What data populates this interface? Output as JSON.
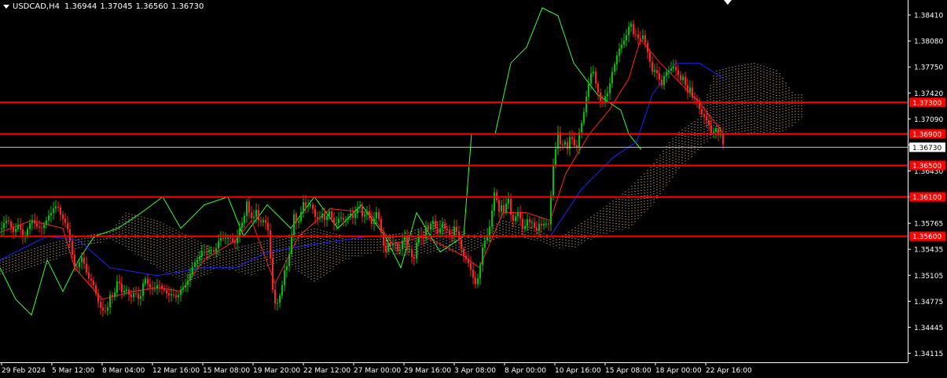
{
  "window": {
    "symbol": "USDCAD,H4",
    "open": "1.36944",
    "high": "1.37045",
    "low": "1.36560",
    "close": "1.36730"
  },
  "colors": {
    "background": "#000000",
    "axis": "#ffffff",
    "bull_candle": "#00c000",
    "bear_candle": "#ff2020",
    "tenkan": "#ff2020",
    "kijun": "#2020ff",
    "chikou": "#30ff30",
    "cloud": "#ffdab0",
    "level_line": "#ff0000",
    "price_line": "#c0c0c0"
  },
  "chart_data": {
    "type": "candlestick",
    "instrument": "USDCAD",
    "timeframe": "H4",
    "indicator": "Ichimoku Kinko Hyo",
    "ylim": [
      1.34,
      1.386
    ],
    "y_ticks": [
      "1.38410",
      "1.38080",
      "1.37750",
      "1.37420",
      "1.37090",
      "1.36760",
      "1.36430",
      "1.36100",
      "1.35765",
      "1.35435",
      "1.35105",
      "1.34775",
      "1.34445",
      "1.34115"
    ],
    "x_ticks": [
      "29 Feb 2024",
      "5 Mar 12:00",
      "8 Mar 04:00",
      "12 Mar 16:00",
      "15 Mar 08:00",
      "19 Mar 20:00",
      "22 Mar 12:00",
      "27 Mar 00:00",
      "29 Mar 16:00",
      "3 Apr 08:00",
      "8 Apr 00:00",
      "10 Apr 16:00",
      "15 Apr 08:00",
      "18 Apr 00:00",
      "22 Apr 16:00"
    ],
    "current_price": "1.36730",
    "levels": [
      {
        "label": "1.37300",
        "value": 1.373
      },
      {
        "label": "1.36900",
        "value": 1.369
      },
      {
        "label": "1.36500",
        "value": 1.365
      },
      {
        "label": "1.36100",
        "value": 1.361
      },
      {
        "label": "1.35600",
        "value": 1.356
      }
    ],
    "close_path": [
      [
        0,
        1.3569
      ],
      [
        6,
        1.3575
      ],
      [
        12,
        1.358
      ],
      [
        18,
        1.3565
      ],
      [
        24,
        1.3572
      ],
      [
        30,
        1.356
      ],
      [
        36,
        1.357
      ],
      [
        42,
        1.358
      ],
      [
        48,
        1.3575
      ],
      [
        54,
        1.3566
      ],
      [
        58,
        1.3578
      ],
      [
        62,
        1.359
      ],
      [
        68,
        1.3593
      ],
      [
        74,
        1.3596
      ],
      [
        80,
        1.3585
      ],
      [
        85,
        1.357
      ],
      [
        90,
        1.3548
      ],
      [
        96,
        1.352
      ],
      [
        100,
        1.3522
      ],
      [
        104,
        1.353
      ],
      [
        108,
        1.3525
      ],
      [
        112,
        1.351
      ],
      [
        118,
        1.3497
      ],
      [
        124,
        1.3482
      ],
      [
        128,
        1.3472
      ],
      [
        132,
        1.3462
      ],
      [
        136,
        1.3462
      ],
      [
        140,
        1.3488
      ],
      [
        145,
        1.3485
      ],
      [
        150,
        1.3503
      ],
      [
        155,
        1.349
      ],
      [
        160,
        1.3497
      ],
      [
        166,
        1.3477
      ],
      [
        172,
        1.3493
      ],
      [
        178,
        1.3478
      ],
      [
        184,
        1.3506
      ],
      [
        190,
        1.35
      ],
      [
        196,
        1.3488
      ],
      [
        202,
        1.35
      ],
      [
        208,
        1.3495
      ],
      [
        214,
        1.348
      ],
      [
        220,
        1.349
      ],
      [
        226,
        1.3482
      ],
      [
        232,
        1.3492
      ],
      [
        238,
        1.3505
      ],
      [
        244,
        1.3515
      ],
      [
        250,
        1.353
      ],
      [
        256,
        1.3542
      ],
      [
        262,
        1.3535
      ],
      [
        268,
        1.3547
      ],
      [
        274,
        1.354
      ],
      [
        280,
        1.3556
      ],
      [
        286,
        1.3562
      ],
      [
        292,
        1.3555
      ],
      [
        298,
        1.355
      ],
      [
        304,
        1.357
      ],
      [
        310,
        1.3576
      ],
      [
        314,
        1.3605
      ],
      [
        318,
        1.359
      ],
      [
        322,
        1.358
      ],
      [
        326,
        1.359
      ],
      [
        330,
        1.3576
      ],
      [
        334,
        1.3586
      ],
      [
        338,
        1.3576
      ],
      [
        342,
        1.356
      ],
      [
        346,
        1.35
      ],
      [
        350,
        1.3478
      ],
      [
        354,
        1.3475
      ],
      [
        358,
        1.3488
      ],
      [
        362,
        1.3518
      ],
      [
        366,
        1.3528
      ],
      [
        370,
        1.355
      ],
      [
        374,
        1.3585
      ],
      [
        378,
        1.3575
      ],
      [
        382,
        1.359
      ],
      [
        386,
        1.3602
      ],
      [
        390,
        1.3592
      ],
      [
        394,
        1.3604
      ],
      [
        398,
        1.3598
      ],
      [
        402,
        1.358
      ],
      [
        406,
        1.3578
      ],
      [
        410,
        1.359
      ],
      [
        414,
        1.3582
      ],
      [
        418,
        1.3592
      ],
      [
        422,
        1.358
      ],
      [
        426,
        1.3575
      ],
      [
        430,
        1.3585
      ],
      [
        434,
        1.3582
      ],
      [
        438,
        1.3576
      ],
      [
        442,
        1.3585
      ],
      [
        446,
        1.3592
      ],
      [
        450,
        1.358
      ],
      [
        454,
        1.3592
      ],
      [
        458,
        1.36
      ],
      [
        462,
        1.3585
      ],
      [
        466,
        1.3592
      ],
      [
        470,
        1.358
      ],
      [
        474,
        1.3575
      ],
      [
        478,
        1.3597
      ],
      [
        482,
        1.358
      ],
      [
        486,
        1.3555
      ],
      [
        490,
        1.354
      ],
      [
        494,
        1.3555
      ],
      [
        498,
        1.3545
      ],
      [
        502,
        1.355
      ],
      [
        506,
        1.3543
      ],
      [
        510,
        1.3548
      ],
      [
        514,
        1.3562
      ],
      [
        518,
        1.354
      ],
      [
        522,
        1.3546
      ],
      [
        526,
        1.3528
      ],
      [
        530,
        1.355
      ],
      [
        534,
        1.356
      ],
      [
        538,
        1.3555
      ],
      [
        542,
        1.3575
      ],
      [
        546,
        1.3565
      ],
      [
        550,
        1.358
      ],
      [
        554,
        1.3572
      ],
      [
        558,
        1.3566
      ],
      [
        562,
        1.3575
      ],
      [
        566,
        1.3567
      ],
      [
        570,
        1.357
      ],
      [
        574,
        1.356
      ],
      [
        578,
        1.357
      ],
      [
        582,
        1.356
      ],
      [
        586,
        1.355
      ],
      [
        590,
        1.3538
      ],
      [
        594,
        1.3527
      ],
      [
        598,
        1.3518
      ],
      [
        602,
        1.351
      ],
      [
        606,
        1.35
      ],
      [
        610,
        1.3513
      ],
      [
        614,
        1.3543
      ],
      [
        618,
        1.356
      ],
      [
        622,
        1.3568
      ],
      [
        626,
        1.359
      ],
      [
        630,
        1.362
      ],
      [
        634,
        1.3592
      ],
      [
        638,
        1.3602
      ],
      [
        642,
        1.3584
      ],
      [
        646,
        1.3612
      ],
      [
        650,
        1.359
      ],
      [
        654,
        1.358
      ],
      [
        658,
        1.359
      ],
      [
        662,
        1.358
      ],
      [
        666,
        1.3568
      ],
      [
        670,
        1.3585
      ],
      [
        674,
        1.3575
      ],
      [
        678,
        1.3575
      ],
      [
        682,
        1.3568
      ],
      [
        686,
        1.3578
      ],
      [
        690,
        1.357
      ],
      [
        694,
        1.3574
      ],
      [
        698,
        1.3578
      ],
      [
        700,
        1.359
      ],
      [
        702,
        1.364
      ],
      [
        706,
        1.366
      ],
      [
        710,
        1.369
      ],
      [
        714,
        1.3675
      ],
      [
        718,
        1.3685
      ],
      [
        722,
        1.3668
      ],
      [
        726,
        1.3688
      ],
      [
        730,
        1.368
      ],
      [
        734,
        1.3675
      ],
      [
        738,
        1.3695
      ],
      [
        742,
        1.3706
      ],
      [
        744,
        1.3728
      ],
      [
        746,
        1.374
      ],
      [
        750,
        1.3762
      ],
      [
        754,
        1.377
      ],
      [
        758,
        1.3752
      ],
      [
        762,
        1.3742
      ],
      [
        766,
        1.3728
      ],
      [
        770,
        1.3735
      ],
      [
        774,
        1.374
      ],
      [
        778,
        1.377
      ],
      [
        782,
        1.378
      ],
      [
        786,
        1.379
      ],
      [
        790,
        1.38
      ],
      [
        794,
        1.3812
      ],
      [
        798,
        1.382
      ],
      [
        802,
        1.383
      ],
      [
        806,
        1.3815
      ],
      [
        810,
        1.382
      ],
      [
        814,
        1.381
      ],
      [
        818,
        1.3812
      ],
      [
        822,
        1.38
      ],
      [
        826,
        1.379
      ],
      [
        830,
        1.377
      ],
      [
        834,
        1.3768
      ],
      [
        838,
        1.376
      ],
      [
        842,
        1.3755
      ],
      [
        846,
        1.377
      ],
      [
        850,
        1.3765
      ],
      [
        854,
        1.3772
      ],
      [
        858,
        1.378
      ],
      [
        862,
        1.3768
      ],
      [
        866,
        1.3755
      ],
      [
        870,
        1.3762
      ],
      [
        874,
        1.3745
      ],
      [
        878,
        1.375
      ],
      [
        882,
        1.3728
      ],
      [
        886,
        1.3735
      ],
      [
        890,
        1.3725
      ],
      [
        894,
        1.3715
      ],
      [
        898,
        1.3705
      ],
      [
        902,
        1.37
      ],
      [
        906,
        1.3692
      ],
      [
        910,
        1.37
      ],
      [
        914,
        1.3685
      ],
      [
        918,
        1.369
      ],
      [
        921,
        1.3673
      ]
    ],
    "tenkan_path": [
      [
        0,
        1.3565
      ],
      [
        40,
        1.358
      ],
      [
        80,
        1.357
      ],
      [
        95,
        1.352
      ],
      [
        130,
        1.348
      ],
      [
        170,
        1.349
      ],
      [
        200,
        1.3495
      ],
      [
        230,
        1.349
      ],
      [
        260,
        1.353
      ],
      [
        300,
        1.3555
      ],
      [
        320,
        1.358
      ],
      [
        350,
        1.35
      ],
      [
        380,
        1.356
      ],
      [
        420,
        1.3595
      ],
      [
        470,
        1.359
      ],
      [
        500,
        1.355
      ],
      [
        540,
        1.356
      ],
      [
        590,
        1.3535
      ],
      [
        610,
        1.352
      ],
      [
        640,
        1.359
      ],
      [
        670,
        1.359
      ],
      [
        700,
        1.358
      ],
      [
        720,
        1.364
      ],
      [
        750,
        1.369
      ],
      [
        775,
        1.372
      ],
      [
        800,
        1.376
      ],
      [
        815,
        1.381
      ],
      [
        840,
        1.378
      ],
      [
        860,
        1.376
      ],
      [
        890,
        1.373
      ],
      [
        921,
        1.369
      ]
    ],
    "kijun_path": [
      [
        0,
        1.353
      ],
      [
        60,
        1.356
      ],
      [
        100,
        1.3555
      ],
      [
        140,
        1.352
      ],
      [
        200,
        1.351
      ],
      [
        260,
        1.352
      ],
      [
        300,
        1.352
      ],
      [
        340,
        1.354
      ],
      [
        400,
        1.355
      ],
      [
        470,
        1.356
      ],
      [
        520,
        1.356
      ],
      [
        600,
        1.356
      ],
      [
        660,
        1.356
      ],
      [
        700,
        1.356
      ],
      [
        740,
        1.362
      ],
      [
        780,
        1.366
      ],
      [
        810,
        1.368
      ],
      [
        830,
        1.374
      ],
      [
        860,
        1.378
      ],
      [
        890,
        1.378
      ],
      [
        921,
        1.376
      ]
    ],
    "chikou_path": [
      [
        0,
        1.352
      ],
      [
        20,
        1.348
      ],
      [
        40,
        1.346
      ],
      [
        60,
        1.353
      ],
      [
        80,
        1.349
      ],
      [
        100,
        1.353
      ],
      [
        120,
        1.356
      ],
      [
        150,
        1.357
      ],
      [
        180,
        1.359
      ],
      [
        207,
        1.361
      ],
      [
        230,
        1.357
      ],
      [
        260,
        1.36
      ],
      [
        290,
        1.361
      ],
      [
        310,
        1.356
      ],
      [
        340,
        1.36
      ],
      [
        370,
        1.357
      ],
      [
        400,
        1.361
      ],
      [
        430,
        1.357
      ],
      [
        460,
        1.36
      ],
      [
        490,
        1.356
      ],
      [
        510,
        1.352
      ],
      [
        530,
        1.359
      ],
      [
        560,
        1.354
      ],
      [
        590,
        1.356
      ],
      [
        600,
        1.369
      ],
      [
        630,
        1.369
      ],
      [
        650,
        1.378
      ],
      [
        670,
        1.38
      ],
      [
        690,
        1.385
      ],
      [
        710,
        1.384
      ],
      [
        730,
        1.378
      ],
      [
        760,
        1.374
      ],
      [
        790,
        1.372
      ],
      [
        800,
        1.369
      ],
      [
        816,
        1.367
      ]
    ],
    "cloud": [
      {
        "x": 0,
        "a": 1.351,
        "b": 1.353
      },
      {
        "x": 60,
        "a": 1.3525,
        "b": 1.355
      },
      {
        "x": 100,
        "a": 1.3545,
        "b": 1.356
      },
      {
        "x": 140,
        "a": 1.3555,
        "b": 1.3565
      },
      {
        "x": 160,
        "a": 1.3545,
        "b": 1.359
      },
      {
        "x": 200,
        "a": 1.352,
        "b": 1.358
      },
      {
        "x": 240,
        "a": 1.35,
        "b": 1.356
      },
      {
        "x": 280,
        "a": 1.352,
        "b": 1.354
      },
      {
        "x": 320,
        "a": 1.351,
        "b": 1.355
      },
      {
        "x": 360,
        "a": 1.353,
        "b": 1.356
      },
      {
        "x": 400,
        "a": 1.35,
        "b": 1.357
      },
      {
        "x": 440,
        "a": 1.353,
        "b": 1.356
      },
      {
        "x": 480,
        "a": 1.354,
        "b": 1.356
      },
      {
        "x": 520,
        "a": 1.3535,
        "b": 1.3565
      },
      {
        "x": 560,
        "a": 1.354,
        "b": 1.358
      },
      {
        "x": 600,
        "a": 1.354,
        "b": 1.356
      },
      {
        "x": 640,
        "a": 1.356,
        "b": 1.358
      },
      {
        "x": 680,
        "a": 1.3555,
        "b": 1.357
      },
      {
        "x": 710,
        "a": 1.3545,
        "b": 1.3555
      },
      {
        "x": 730,
        "a": 1.3545,
        "b": 1.357
      },
      {
        "x": 760,
        "a": 1.356,
        "b": 1.359
      },
      {
        "x": 800,
        "a": 1.357,
        "b": 1.362
      },
      {
        "x": 830,
        "a": 1.36,
        "b": 1.365
      },
      {
        "x": 860,
        "a": 1.364,
        "b": 1.369
      },
      {
        "x": 890,
        "a": 1.367,
        "b": 1.371
      },
      {
        "x": 910,
        "a": 1.369,
        "b": 1.377
      },
      {
        "x": 930,
        "a": 1.369,
        "b": 1.3775
      },
      {
        "x": 960,
        "a": 1.369,
        "b": 1.378
      },
      {
        "x": 990,
        "a": 1.369,
        "b": 1.377
      },
      {
        "x": 1010,
        "a": 1.37,
        "b": 1.374
      },
      {
        "x": 1022,
        "a": 1.371,
        "b": 1.374
      }
    ]
  }
}
